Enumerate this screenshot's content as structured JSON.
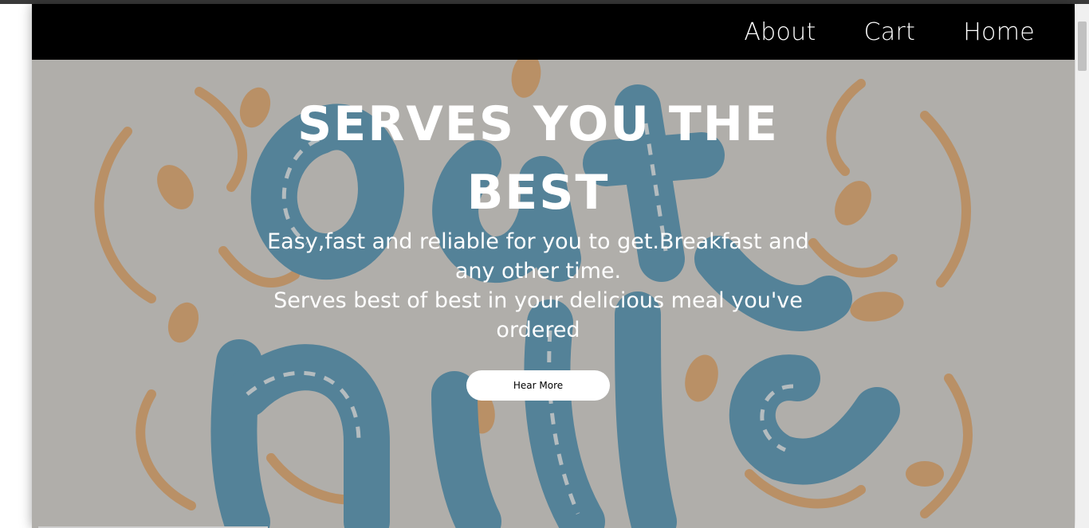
{
  "nav": {
    "items": [
      {
        "label": "About"
      },
      {
        "label": "Cart"
      },
      {
        "label": "Home"
      }
    ]
  },
  "hero": {
    "title": "SERVES YOU THE BEST",
    "description_line1": "Easy,fast and reliable for you to get.Breakfast and any other time.",
    "description_line2": "Serves best of best in your delicious meal you've ordered",
    "button_label": "Hear More"
  },
  "colors": {
    "navbar": "#000000",
    "hero_tint": "#828282",
    "art_blue": "#3b8ab0",
    "art_orange": "#e9a25a",
    "button_bg": "#ffffff"
  }
}
